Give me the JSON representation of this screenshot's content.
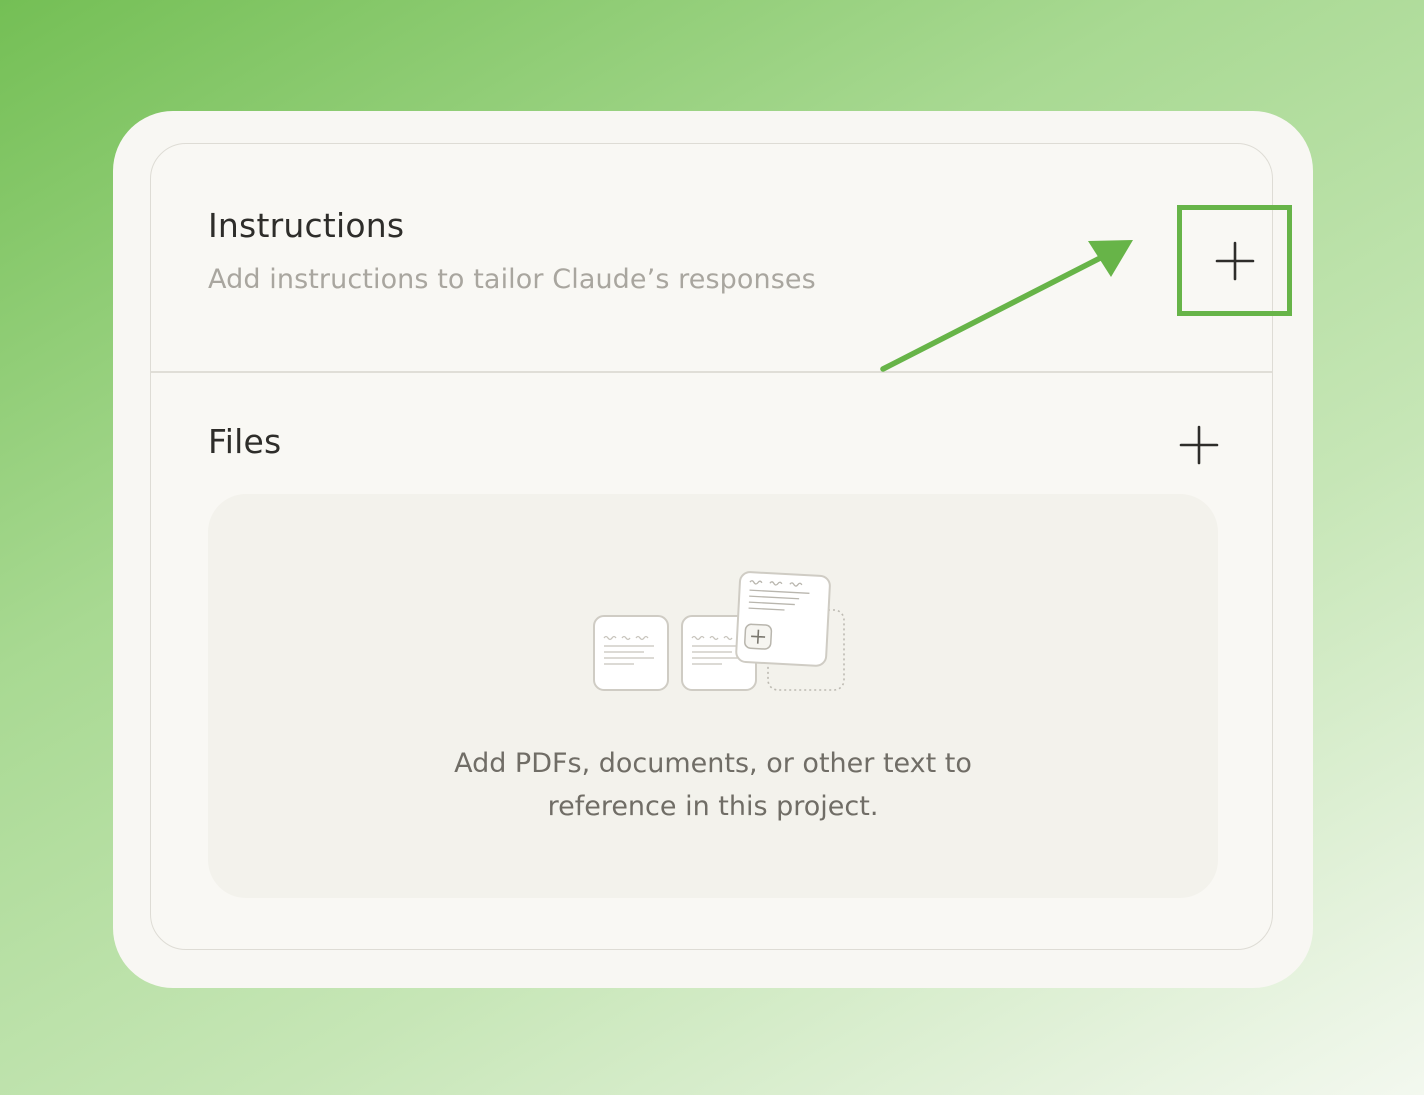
{
  "instructions": {
    "title": "Instructions",
    "description": "Add instructions to tailor Claude’s responses",
    "add_icon": "plus-icon"
  },
  "files": {
    "title": "Files",
    "add_icon": "plus-icon",
    "empty_state": {
      "line1": "Add PDFs, documents, or other text to",
      "line2": "reference in this project.",
      "illustration_icon": "documents-stack-icon"
    }
  },
  "annotation": {
    "highlight_color": "#67b448",
    "arrow_color": "#67b448"
  }
}
